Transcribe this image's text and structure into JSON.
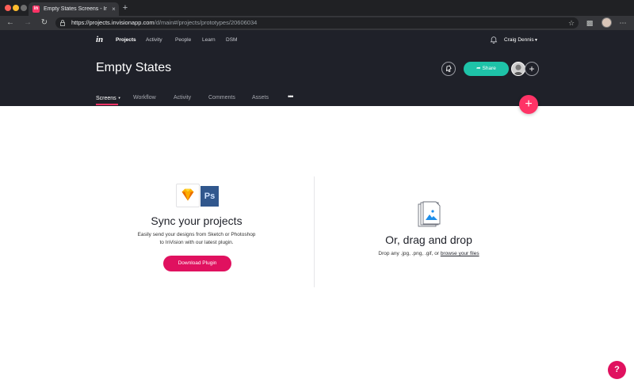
{
  "browser": {
    "tab_title": "Empty States Screens - InVision",
    "tab_favicon": "in",
    "tab_close": "×",
    "new_tab": "+",
    "url_main": "https://projects.invisionapp.com",
    "url_rest": "/d/main#/projects/prototypes/20606034"
  },
  "header": {
    "logo": "in",
    "topnav": [
      "Projects",
      "Activity",
      "People",
      "Learn",
      "DSM"
    ],
    "user_name": "Craig Dennis",
    "page_title": "Empty States",
    "share_label": "Share",
    "subnav": [
      "Screens",
      "Workflow",
      "Activity",
      "Comments",
      "Assets"
    ],
    "more": "•••"
  },
  "sync": {
    "ps_label": "Ps",
    "title": "Sync your projects",
    "desc_line1": "Easily send your designs from Sketch or Photoshop",
    "desc_line2": "to InVision with our latest plugin.",
    "button_label": "Download Plugin"
  },
  "drop": {
    "title": "Or, drag and drop",
    "desc": "Drop any .jpg, .png, .gif, or ",
    "browse_link": "browse your files"
  },
  "colors": {
    "header_bg": "#1f2129",
    "accent_pink": "#ff3366",
    "share_green": "#1ec3a8",
    "button_pink": "#e0115f"
  }
}
